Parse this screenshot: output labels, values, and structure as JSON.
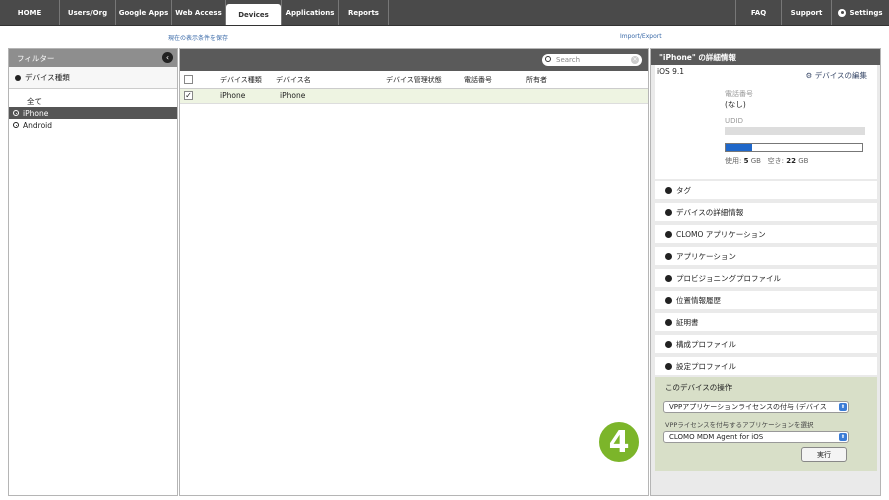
{
  "nav": {
    "items": [
      {
        "label": "HOME"
      },
      {
        "label": "Users/Org"
      },
      {
        "label": "Google Apps"
      },
      {
        "label": "Web Access"
      },
      {
        "label": "Devices"
      },
      {
        "label": "Applications"
      },
      {
        "label": "Reports"
      }
    ],
    "faq": "FAQ",
    "support": "Support",
    "settings": "Settings"
  },
  "links": {
    "save_filter": "現在の表示条件を保存",
    "import_export": "Import/Export"
  },
  "filter": {
    "header": "フィルター",
    "category": "デバイス種類",
    "all": "全て",
    "options": [
      "iPhone",
      "Android"
    ]
  },
  "list": {
    "search_placeholder": "Search",
    "columns": [
      "デバイス種類",
      "デバイス名",
      "デバイス管理状態",
      "電話番号",
      "所有者"
    ],
    "rows": [
      {
        "type": "iPhone",
        "name": "iPhone",
        "checked": "✓"
      }
    ]
  },
  "detail": {
    "title": "\"iPhone\" の詳細情報",
    "os": "iOS 9.1",
    "edit": "デバイスの編集",
    "phone_label": "電話番号",
    "phone_value": "(なし)",
    "udid_label": "UDID",
    "storage_used_fraction": 0.19,
    "usage_used_label": "使用:",
    "usage_used": "5",
    "usage_free_label": "空き:",
    "usage_free": "22",
    "usage_unit": "GB",
    "sections": [
      "タグ",
      "デバイスの詳細情報",
      "CLOMO アプリケーション",
      "アプリケーション",
      "プロビジョニングプロファイル",
      "位置情報履歴",
      "証明書",
      "構成プロファイル",
      "設定プロファイル"
    ],
    "ops": {
      "title": "このデバイスの操作",
      "action": "VPPアプリケーションライセンスの付与 (デバイス",
      "app_label": "VPPライセンスを付与するアプリケーションを選択",
      "app": "CLOMO MDM Agent for iOS",
      "run": "実行"
    }
  },
  "callout": "4"
}
